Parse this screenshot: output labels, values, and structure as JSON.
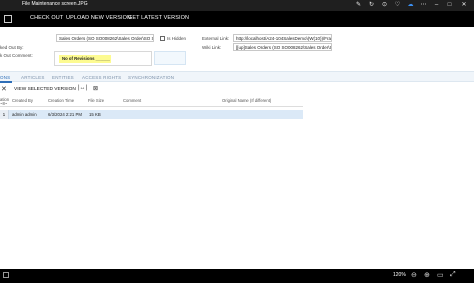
{
  "window": {
    "title": "File Maintenance screen.JPG"
  },
  "toolbar": {
    "check_out": "CHECK OUT",
    "upload": "UPLOAD NEW VERSION",
    "get_latest": "GET LATEST VERSION"
  },
  "form": {
    "file_name_value": "Sales Orders (SO SO008262\\Sales Order\\SO SO",
    "is_hidden_label": "Is Hidden",
    "external_link_label": "External Link:",
    "external_link_value": "http://localhost/A24-104SalesDemo\\(W(10))/Fram",
    "wiki_link_label": "Wiki Link:",
    "wiki_link_value": "[[up]Sales Orders (SO SO008262\\Sales Order\\S",
    "checked_out_by_label": "ked Out By:",
    "checkout_comment_label": "k Out Comment:",
    "annotation": "No of Revisions ______"
  },
  "tabs": [
    {
      "label": "ONS"
    },
    {
      "label": "ARTICLES"
    },
    {
      "label": "ENTITIES"
    },
    {
      "label": "ACCESS RIGHTS"
    },
    {
      "label": "SYNCHRONIZATION"
    }
  ],
  "grid_toolbar": {
    "view_selected_version": "VIEW SELECTED VERSION"
  },
  "table": {
    "headers": {
      "version": "ation",
      "version2": "~8~",
      "created_by": "Created By",
      "creation_time": "Creation Time",
      "file_size": "File Size",
      "comment": "Comment",
      "original_name": "Original Name (If different)"
    },
    "rows": [
      {
        "version": "1",
        "created_by": "admin admin",
        "creation_time": "6/3/2024 2:21 PM",
        "file_size": "15 KB",
        "comment": "",
        "original_name": ""
      }
    ]
  },
  "status": {
    "zoom": "120%"
  },
  "icons": {
    "toolbar": [
      "edit-icon",
      "refresh-icon",
      "zoom-icon",
      "favorite-icon",
      "cloud-icon",
      "more-icon"
    ],
    "window": [
      "minimize-icon",
      "close-icon"
    ],
    "status": [
      "zoom-out-icon",
      "zoom-in-icon",
      "fit-icon",
      "fullscreen-icon"
    ]
  }
}
